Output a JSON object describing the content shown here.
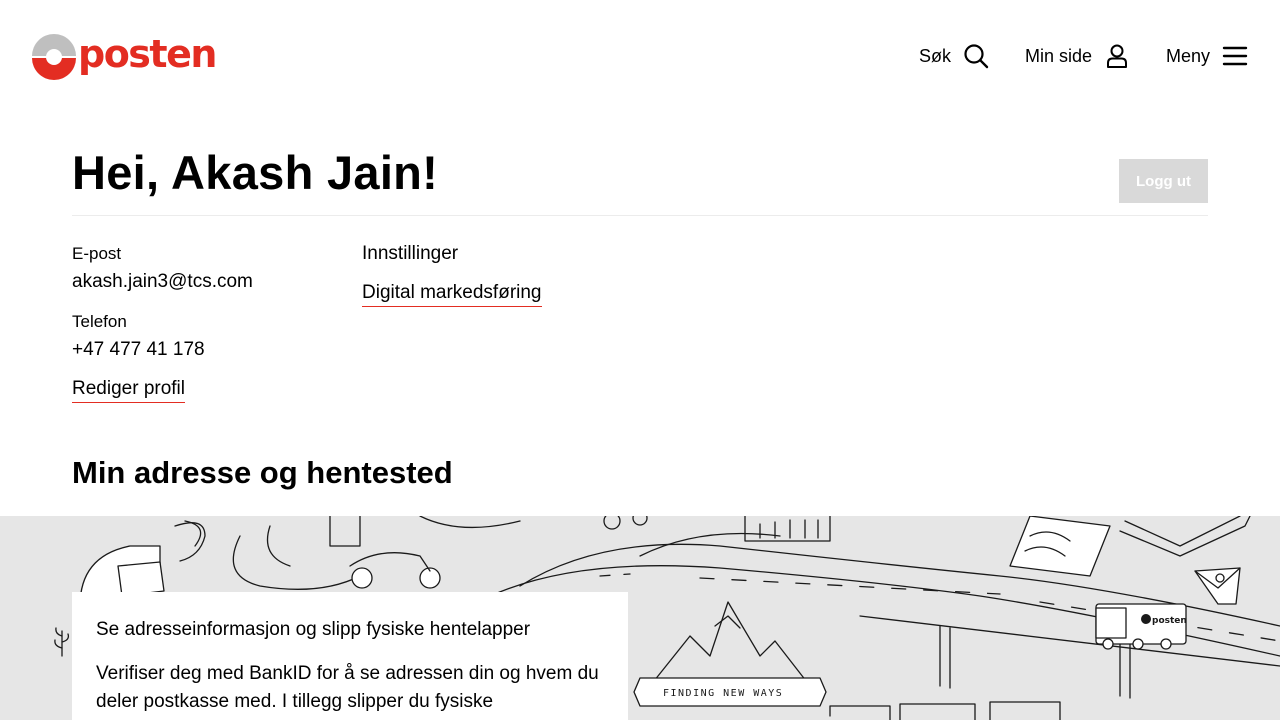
{
  "brand": {
    "name": "posten",
    "red": "#e32d22",
    "grey": "#bfbfbf"
  },
  "nav": {
    "search_label": "Søk",
    "mypage_label": "Min side",
    "menu_label": "Meny",
    "icons": [
      "search-icon",
      "user-icon",
      "hamburger-menu-icon"
    ]
  },
  "greeting": {
    "title": "Hei, Akash Jain!",
    "logout_label": "Logg ut"
  },
  "profile": {
    "email_label": "E-post",
    "email_value": "akash.jain3@tcs.com",
    "phone_label": "Telefon",
    "phone_value": "+47 477 41 178",
    "edit_link": "Rediger profil"
  },
  "settings": {
    "title": "Innstillinger",
    "marketing_link": "Digital markedsføring"
  },
  "address": {
    "section_title": "Min adresse og hentested",
    "card_title": "Se adresseinformasjon og slipp fysiske hentelapper",
    "card_body": "Verifiser deg med BankID for å se adressen din og hvem du deler postkasse med. I tillegg slipper du fysiske",
    "illustration_banner": "FINDING NEW WAYS",
    "truck_label": "posten"
  }
}
